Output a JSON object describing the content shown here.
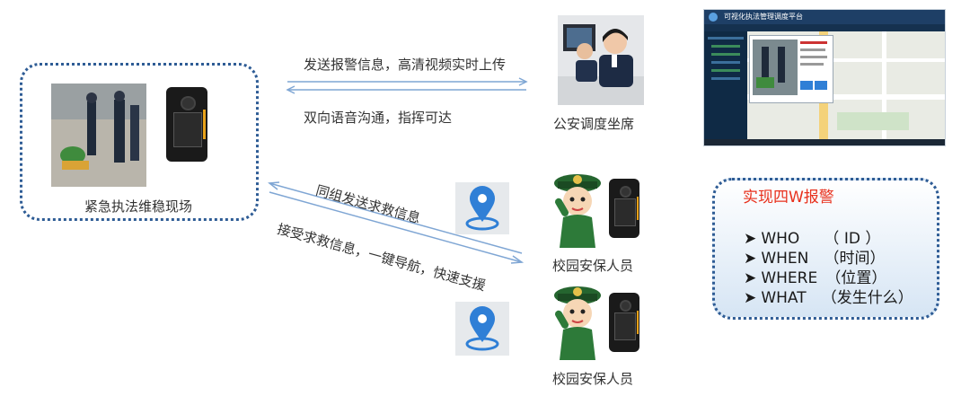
{
  "scene": {
    "label": "紧急执法维稳现场"
  },
  "arrows": {
    "top_label": "发送报警信息，高清视频实时上传",
    "bottom_label": "双向语音沟通，指挥可达",
    "diag_upper_label": "同组发送求救信息",
    "diag_lower_label": "接受求救信息，一键导航，快速支援"
  },
  "dispatch": {
    "label": "公安调度坐席"
  },
  "platform": {
    "title": "可视化执法管理调度平台"
  },
  "guards": [
    {
      "label": "校园安保人员"
    },
    {
      "label": "校园安保人员"
    }
  ],
  "four_w": {
    "title": "实现四W报警",
    "items": [
      {
        "key": "WHO",
        "desc": "（   ID  ）"
      },
      {
        "key": "WHEN",
        "desc": "（时间）"
      },
      {
        "key": "WHERE",
        "desc": "（位置）"
      },
      {
        "key": "WHAT",
        "desc": "（发生什么）"
      }
    ]
  },
  "colors": {
    "accent": "#2e5c95",
    "arrow": "#7fa6d4",
    "red": "#e8301c",
    "pin": "#2f7fd6"
  }
}
